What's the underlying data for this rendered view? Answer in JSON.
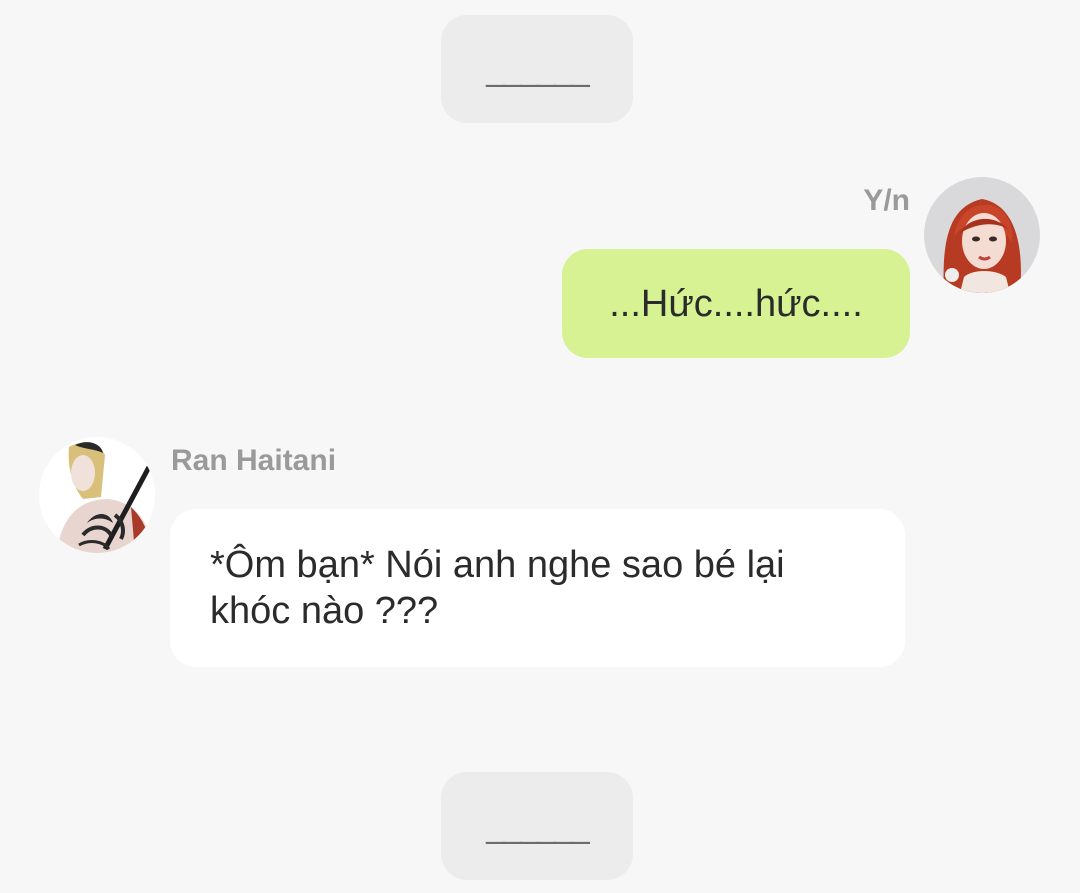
{
  "dividers": {
    "top": "______",
    "bottom": "______"
  },
  "messages": [
    {
      "sender": "Y/n",
      "side": "right",
      "text": "...Hức....hức....",
      "bubble_color": "#d6f293",
      "avatar": "red-haired-girl-avatar"
    },
    {
      "sender": "Ran Haitani",
      "side": "left",
      "text": "*Ôm bạn* Nói anh nghe sao bé lại khóc nào ???",
      "bubble_color": "#ffffff",
      "avatar": "tattooed-character-avatar"
    }
  ],
  "colors": {
    "background": "#f7f7f7",
    "divider": "#ececec",
    "name_text": "#9a9a9a",
    "message_text": "#2b2b2b"
  }
}
